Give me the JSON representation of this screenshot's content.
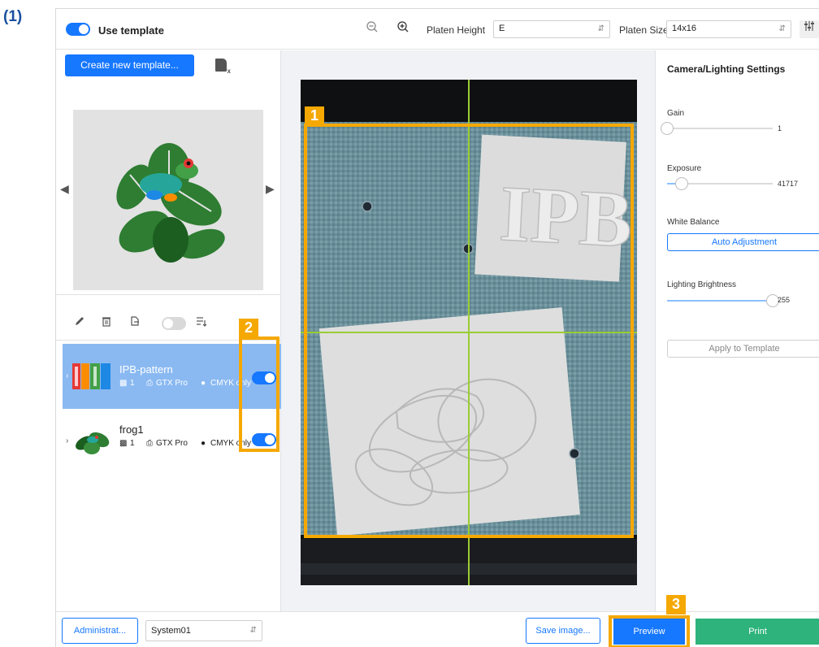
{
  "figure_label": "(1)",
  "toolbar": {
    "use_template_label": "Use template",
    "platen_height_label": "Platen Height",
    "platen_height_value": "E",
    "platen_size_label": "Platen Size",
    "platen_size_value": "14x16"
  },
  "left_panel": {
    "create_button": "Create new template...",
    "templates": [
      {
        "name": "IPB-pattern",
        "count": "1",
        "printer": "GTX Pro",
        "ink": "CMYK only",
        "enabled": true,
        "selected": true
      },
      {
        "name": "frog1",
        "count": "1",
        "printer": "GTX Pro",
        "ink": "CMYK only",
        "enabled": true,
        "selected": false
      }
    ]
  },
  "camera_view": {
    "logo_text": "IPB"
  },
  "highlights": [
    "1",
    "2",
    "3"
  ],
  "settings": {
    "title": "Camera/Lighting Settings",
    "gain_label": "Gain",
    "gain_value": "1",
    "gain_level": 0.0,
    "exposure_label": "Exposure",
    "exposure_value": "41717",
    "exposure_level": 0.14,
    "white_balance_label": "White Balance",
    "auto_adjust_button": "Auto Adjustment",
    "lighting_label": "Lighting Brightness",
    "lighting_value": "255",
    "lighting_level": 1.0,
    "apply_button": "Apply to Template"
  },
  "bottom_bar": {
    "admin_button": "Administrat...",
    "system_value": "System01",
    "save_button": "Save image...",
    "preview_button": "Preview",
    "print_button": "Print"
  },
  "colors": {
    "accent": "#1677ff",
    "highlight": "#f5a800",
    "print_green": "#2db37b",
    "guide_line": "#9acd32"
  }
}
